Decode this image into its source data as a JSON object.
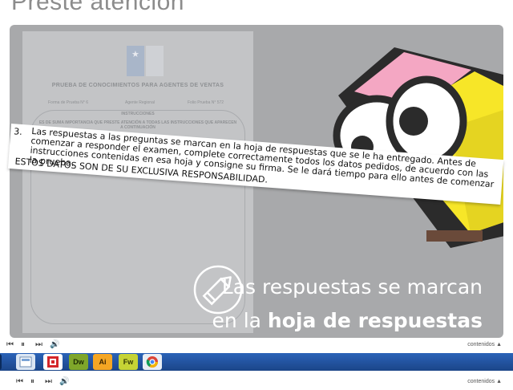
{
  "page": {
    "title": "Preste atención"
  },
  "document": {
    "heading": "PRUEBA DE CONOCIMIENTOS PARA AGENTES DE VENTAS",
    "fields": [
      "Forma de Prueba   N° 6",
      "Agente Regional",
      "Folio Prueba   N° 572"
    ],
    "instructions_title": "INSTRUCCIONES",
    "instructions_subtitle": "ES DE SUMA IMPORTANCIA QUE PRESTE ATENCIÓN A TODAS LAS INSTRUCCIONES QUE APARECEN A CONTINUACIÓN"
  },
  "highlight": {
    "number": "3.",
    "text": "Las respuestas a las preguntas se marcan en la hoja de respuestas que se le ha entregado.  Antes de comenzar a responder el examen, complete correctamente todos los datos pedidos, de acuerdo con las instrucciones contenidas en esa hoja y consigne su firma.  Se le dará tiempo para ello antes de comenzar la prueba.",
    "emphasis": "ESTOS DATOS SON DE SU EXCLUSIVA RESPONSABILIDAD."
  },
  "caption": {
    "line1": "Las respuestas se marcan",
    "line2_prefix": "en la ",
    "line2_bold": "hoja de respuestas"
  },
  "player": {
    "contents_label": "contenidos ▲"
  },
  "taskbar": {
    "apps": [
      {
        "label": "Dw",
        "color": "#7fa62a",
        "text_color": "#1c2a05"
      },
      {
        "label": "Ai",
        "color": "#f5a623",
        "text_color": "#3a2300"
      },
      {
        "label": "Fw",
        "color": "#c6d335",
        "text_color": "#333a05"
      }
    ]
  },
  "colors": {
    "stage": "#a8a9ab",
    "mascot_yellow": "#f7e628",
    "mascot_dark": "#2b2b2b",
    "eraser_pink": "#f4a7c3",
    "taskbar_blue": "#2b63b8"
  }
}
